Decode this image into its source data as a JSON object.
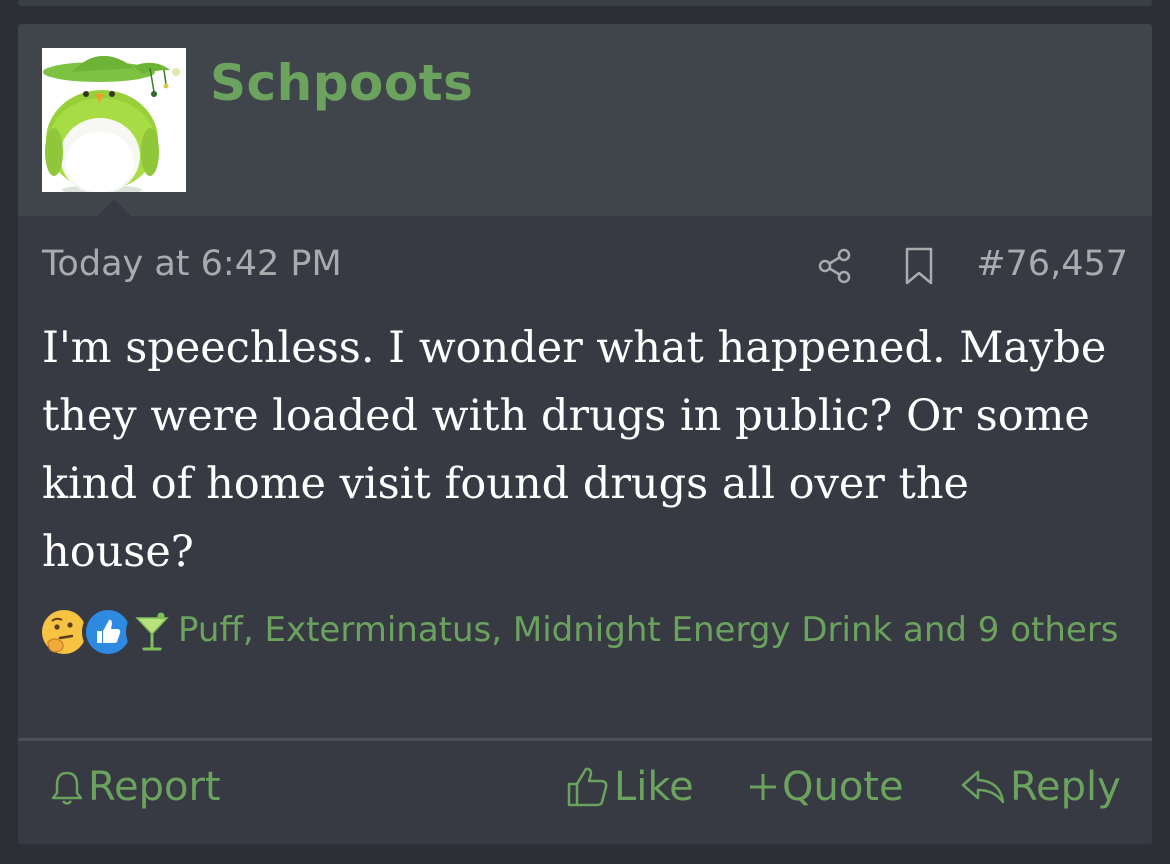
{
  "user": {
    "name": "Schpoots"
  },
  "post": {
    "date": "Today at 6:42 PM",
    "number": "#76,457",
    "message": "I'm speechless. I wonder what happened. Maybe they were loaded with drugs in public? Or some kind of home visit found drugs all over the house?",
    "icons": {
      "share": "share-icon",
      "bookmark": "bookmark-icon"
    }
  },
  "reactions": {
    "icons": [
      "thinking-face-icon",
      "like-icon",
      "cocktail-icon"
    ],
    "text": "Puff, Exterminatus, Midnight Energy Drink and 9 others"
  },
  "actions": {
    "report": "Report",
    "like": "Like",
    "quote": "Quote",
    "reply": "Reply"
  },
  "colors": {
    "accent": "#6ba35e",
    "background": "#2c2f35",
    "post_bg": "#373a42",
    "header_bg": "#40444b",
    "meta_text": "#a9abaf",
    "message_text": "#ffffff"
  }
}
